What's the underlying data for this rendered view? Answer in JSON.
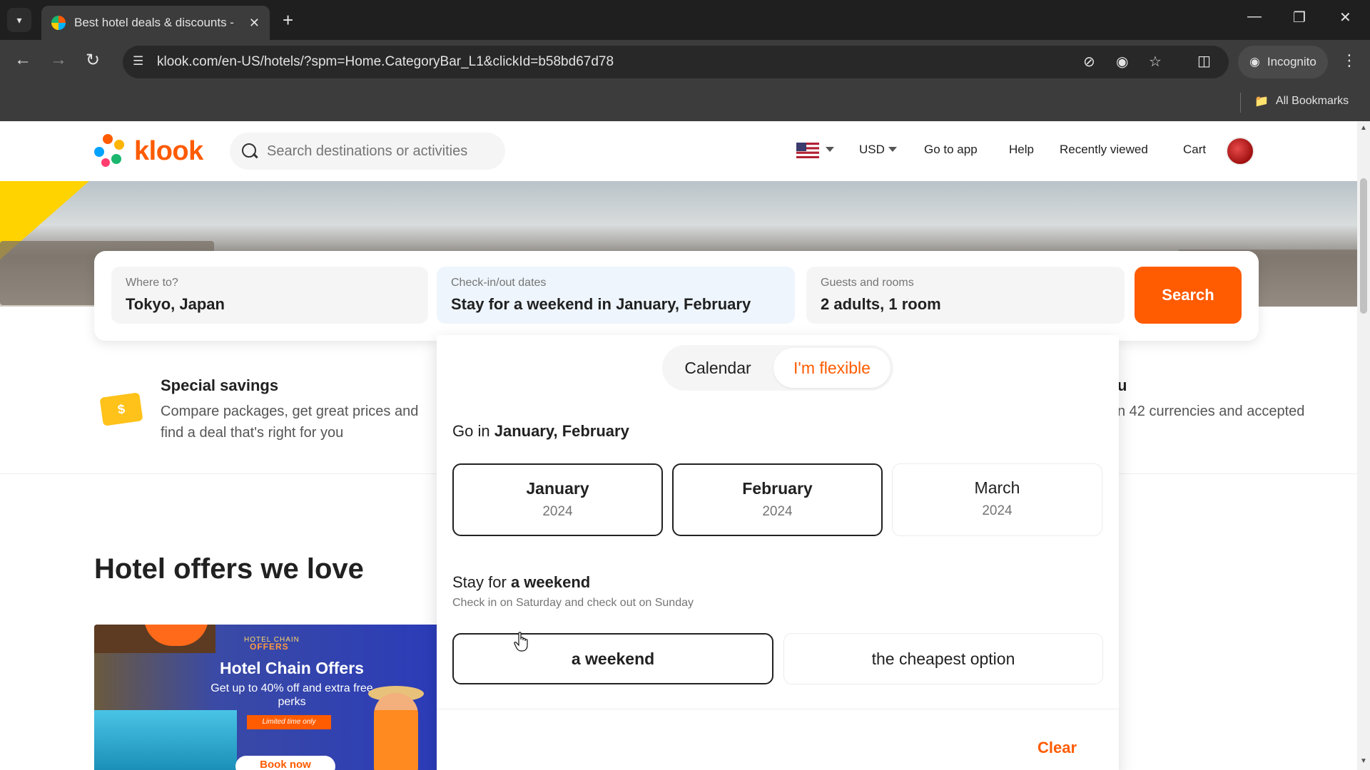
{
  "browser": {
    "tab_title": "Best hotel deals & discounts - ",
    "url": "klook.com/en-US/hotels/?spm=Home.CategoryBar_L1&clickId=b58bd67d78",
    "incognito_label": "Incognito",
    "all_bookmarks_label": "All Bookmarks"
  },
  "header": {
    "logo_text": "klook",
    "search_placeholder": "Search destinations or activities",
    "currency": "USD",
    "go_to_app": "Go to app",
    "help": "Help",
    "recently_viewed": "Recently viewed",
    "cart": "Cart"
  },
  "search_panel": {
    "where_label": "Where to?",
    "where_value": "Tokyo, Japan",
    "dates_label": "Check-in/out dates",
    "dates_value": "Stay for a weekend in January, February",
    "guests_label": "Guests and rooms",
    "guests_value": "2 adults, 1 room",
    "search_button": "Search"
  },
  "features": {
    "left_icon_symbol": "$",
    "left_title": "Special savings",
    "left_desc": "Compare packages, get great prices and find a deal that's right for you",
    "right_title": "u",
    "right_desc": "n 42 currencies and accepted"
  },
  "section": {
    "title": "Hotel offers we love"
  },
  "promo": {
    "chain_small": "HOTEL CHAIN",
    "offers_small": "OFFERS",
    "title": "Hotel Chain Offers",
    "desc": "Get up to 40% off and extra free perks",
    "tag": "Limited time only",
    "button": "Book now"
  },
  "date_picker": {
    "tab_calendar": "Calendar",
    "tab_flexible": "I'm flexible",
    "go_in_prefix": "Go in",
    "go_in_value": "January, February",
    "months": [
      {
        "name": "January",
        "year": "2024",
        "selected": true
      },
      {
        "name": "February",
        "year": "2024",
        "selected": true
      },
      {
        "name": "March",
        "year": "2024",
        "selected": false
      }
    ],
    "stay_prefix": "Stay for",
    "stay_value": "a weekend",
    "stay_sub": "Check in on Saturday and check out on Sunday",
    "stay_options": [
      {
        "label": "a weekend",
        "selected": true
      },
      {
        "label": "the cheapest option",
        "selected": false
      }
    ],
    "clear_label": "Clear"
  },
  "colors": {
    "brand": "#ff5b00",
    "text": "#212121",
    "muted": "#757575"
  }
}
